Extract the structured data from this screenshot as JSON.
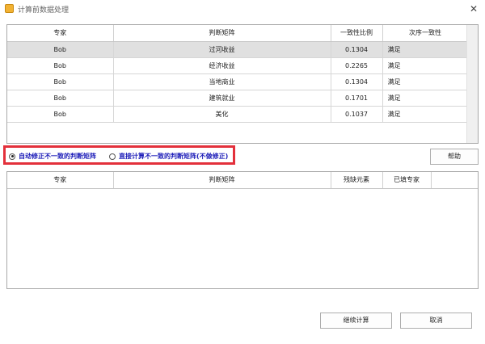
{
  "window": {
    "title": "计算前数据处理",
    "close_glyph": "✕",
    "icon": "app-icon"
  },
  "top_table": {
    "columns": [
      "专家",
      "判断矩阵",
      "一致性比例",
      "次序一致性"
    ],
    "rows": [
      {
        "expert": "Bob",
        "matrix": "过河收益",
        "ratio": "0.1304",
        "order": "满足",
        "selected": true
      },
      {
        "expert": "Bob",
        "matrix": "经济收益",
        "ratio": "0.2265",
        "order": "满足",
        "selected": false
      },
      {
        "expert": "Bob",
        "matrix": "当地商业",
        "ratio": "0.1304",
        "order": "满足",
        "selected": false
      },
      {
        "expert": "Bob",
        "matrix": "建筑就业",
        "ratio": "0.1701",
        "order": "满足",
        "selected": false
      },
      {
        "expert": "Bob",
        "matrix": "美化",
        "ratio": "0.1037",
        "order": "满足",
        "selected": false
      }
    ]
  },
  "options": {
    "auto_fix_label": "自动修正不一致的判断矩阵",
    "direct_label": "直接计算不一致的判断矩阵(不做修正)",
    "selected": "auto_fix"
  },
  "bottom_table": {
    "columns": [
      "专家",
      "判断矩阵",
      "残缺元素",
      "已填专家"
    ],
    "rows": []
  },
  "buttons": {
    "help": "帮助",
    "continue": "继续计算",
    "cancel": "取消"
  },
  "colors": {
    "highlight_border": "#e3303b",
    "option_text": "#1a1ab8",
    "selected_row": "#e0e0e0"
  }
}
